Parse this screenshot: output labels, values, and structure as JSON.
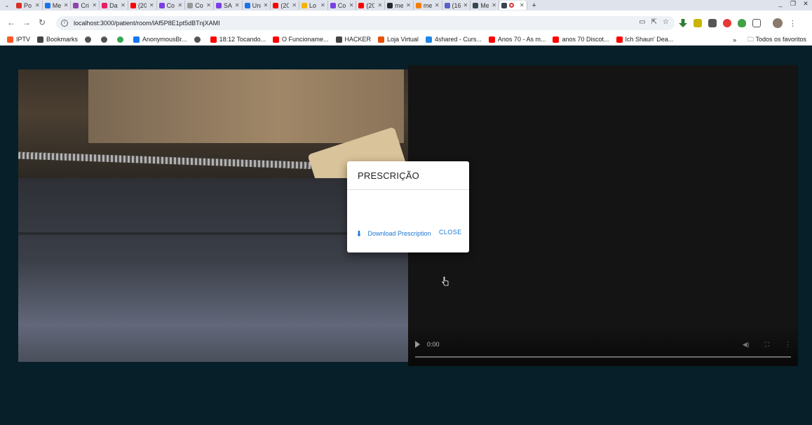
{
  "browser": {
    "tabs": [
      {
        "label": "Po",
        "color": "#d93025"
      },
      {
        "label": "Me",
        "color": "#1a73e8"
      },
      {
        "label": "Cri",
        "color": "#8e44ad"
      },
      {
        "label": "Dat",
        "color": "#e91e63"
      },
      {
        "label": "(20",
        "color": "#ff0000"
      },
      {
        "label": "Co",
        "color": "#7b3fe4"
      },
      {
        "label": "Co",
        "color": "#999999"
      },
      {
        "label": "SA",
        "color": "#7b3fe4"
      },
      {
        "label": "Uni",
        "color": "#1a73e8"
      },
      {
        "label": "(20",
        "color": "#ff0000"
      },
      {
        "label": "Lo",
        "color": "#f4b400"
      },
      {
        "label": "Co",
        "color": "#7b3fe4"
      },
      {
        "label": "(20",
        "color": "#ff0000"
      },
      {
        "label": "me",
        "color": "#24292e"
      },
      {
        "label": "me",
        "color": "#f57c00"
      },
      {
        "label": "(16",
        "color": "#5b5fc7"
      },
      {
        "label": "Me",
        "color": "#37474f"
      }
    ],
    "address": "localhost:3000/patient/room/lAf5P8E1pt5dBTnjXAMI",
    "bookmarks": [
      {
        "label": "IPTV",
        "color": "#ff5722"
      },
      {
        "label": "Bookmarks",
        "color": "#444444"
      },
      {
        "label": "",
        "color": "#555555"
      },
      {
        "label": "",
        "color": "#555555"
      },
      {
        "label": "",
        "color": "#34a853"
      },
      {
        "label": "AnonymousBr...",
        "color": "#1877f2"
      },
      {
        "label": "",
        "color": "#555555"
      },
      {
        "label": "18:12 Tocando...",
        "color": "#ff0000"
      },
      {
        "label": "O Funcioname...",
        "color": "#ff0000"
      },
      {
        "label": "HACKER",
        "color": "#444444"
      },
      {
        "label": "Loja Virtual",
        "color": "#e65100"
      },
      {
        "label": "4shared - Curs...",
        "color": "#1e88e5"
      },
      {
        "label": "Anos 70 - As m...",
        "color": "#ff0000"
      },
      {
        "label": "anos 70 Discot...",
        "color": "#ff0000"
      },
      {
        "label": "Ich Shaun' Dea...",
        "color": "#ff0000"
      }
    ],
    "bookmarks_more": "»",
    "all_bookmarks": "Todos os favoritos"
  },
  "video": {
    "remote_time": "0:00"
  },
  "dialog": {
    "title": "PRESCRIÇÃO",
    "download_label": "Download Prescription",
    "close_label": "CLOSE"
  },
  "colors": {
    "accent": "#1976d2",
    "page_background": "#061f28"
  }
}
